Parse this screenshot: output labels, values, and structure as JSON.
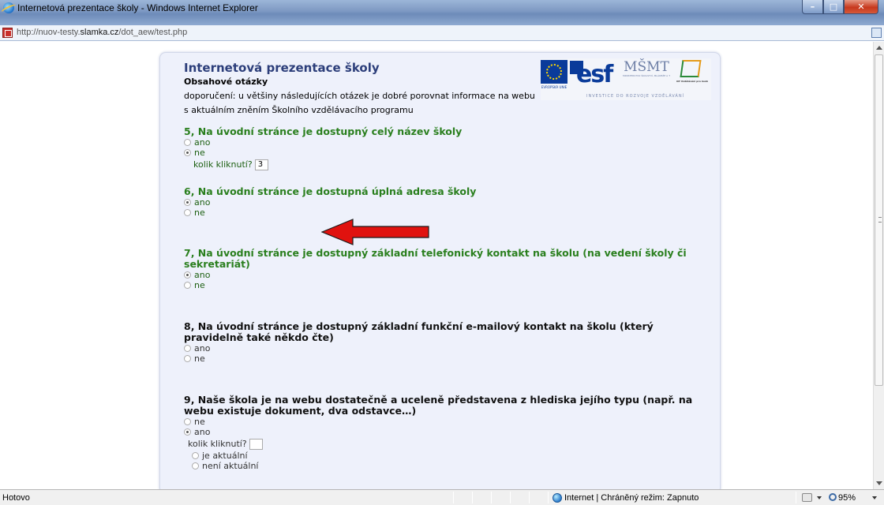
{
  "window": {
    "title": "Internetová prezentace školy - Windows Internet Explorer",
    "controls": {
      "minimize": "–",
      "maximize": "□",
      "close": "✕"
    }
  },
  "address": {
    "url_prefix": "http://nuov-testy.",
    "url_domain": "slamka.cz",
    "url_path": "/dot_aew/test.php"
  },
  "page": {
    "title": "Internetová prezentace školy",
    "subtitle": "Obsahové otázky",
    "note": "doporučení: u většiny následujících otázek je dobré porovnat informace na webu s aktuálním zněním Školního vzdělávacího programu",
    "logos": {
      "eu_text": "EVROPSKÁ UNIE",
      "esf_text": "esf",
      "msmt_big": "MŠMT",
      "msmt_small": "MINISTERSTVO ŠKOLSTVÍ, MLÁDEŽE A TĚLOVÝCHOVY",
      "op_text": "OP Vzdělávání pro konkurenceschopnost",
      "tagline": "INVESTICE DO ROZVOJE VZDĚLÁVÁNÍ"
    }
  },
  "questions": [
    {
      "title": "5, Na úvodní stránce je dostupný celý název školy",
      "options": [
        {
          "label": "ano",
          "checked": false
        },
        {
          "label": "ne",
          "checked": true
        }
      ],
      "count_label": "kolik kliknutí?",
      "count_value": "3"
    },
    {
      "title": "6, Na úvodní stránce je dostupná úplná adresa školy",
      "options": [
        {
          "label": "ano",
          "checked": true
        },
        {
          "label": "ne",
          "checked": false
        }
      ]
    },
    {
      "title": "7, Na úvodní stránce je dostupný základní telefonický kontakt na školu (na vedení školy či sekretariát)",
      "options": [
        {
          "label": "ano",
          "checked": true
        },
        {
          "label": "ne",
          "checked": false
        }
      ]
    },
    {
      "title": "8, Na úvodní stránce je dostupný základní funkční e-mailový kontakt na školu (který pravidelně také někdo čte)",
      "options": [
        {
          "label": "ano",
          "checked": false
        },
        {
          "label": "ne",
          "checked": false
        }
      ]
    },
    {
      "title": "9, Naše škola je na webu dostatečně a uceleně představena z hlediska jejího typu (např. na webu existuje dokument, dva odstavce…)",
      "options": [
        {
          "label": "ne",
          "checked": false
        },
        {
          "label": "ano",
          "checked": true
        }
      ],
      "count_label": "kolik kliknutí?",
      "count_value": "",
      "sub_options": [
        {
          "label": "je aktuální",
          "checked": false
        },
        {
          "label": "není aktuální",
          "checked": false
        }
      ]
    }
  ],
  "status": {
    "text": "Hotovo",
    "zone": "Internet | Chráněný režim: Zapnuto",
    "zoom": "95%"
  },
  "colors": {
    "answered_question": "#2a7f1e",
    "unanswered_question": "#111111",
    "panel_bg": "#eef1fb",
    "annotation_arrow": "#e0120f"
  },
  "icons": [
    "ie-icon",
    "favicon-icon",
    "globe-icon",
    "protected-mode-icon",
    "zoom-icon",
    "arrow-left-annotation"
  ]
}
